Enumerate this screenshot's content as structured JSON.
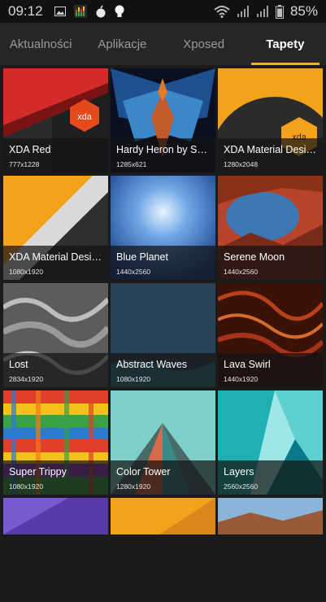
{
  "status_bar": {
    "time": "09:12",
    "battery": "85%",
    "left_icons": [
      "image-icon",
      "equalizer-app-icon",
      "bomb-icon",
      "lightbulb-icon"
    ],
    "right_icons": [
      "wifi-icon",
      "signal-icon",
      "signal-icon",
      "battery-icon"
    ]
  },
  "tabs": [
    {
      "label": "Aktualności",
      "active": false
    },
    {
      "label": "Aplikacje",
      "active": false
    },
    {
      "label": "Xposed",
      "active": false
    },
    {
      "label": "Tapety",
      "active": true
    }
  ],
  "accent_color": "#f2b01e",
  "wallpapers": [
    {
      "name": "XDA Red",
      "resolution": "777x1228"
    },
    {
      "name": "Hardy Heron by S Ri...",
      "resolution": "1285x621"
    },
    {
      "name": "XDA Material Desig...",
      "resolution": "1280x2048"
    },
    {
      "name": "XDA Material Design",
      "resolution": "1080x1920"
    },
    {
      "name": "Blue Planet",
      "resolution": "1440x2560"
    },
    {
      "name": "Serene Moon",
      "resolution": "1440x2560"
    },
    {
      "name": "Lost",
      "resolution": "2834x1920"
    },
    {
      "name": "Abstract Waves",
      "resolution": "1080x1920"
    },
    {
      "name": "Lava Swirl",
      "resolution": "1440x1920"
    },
    {
      "name": "Super Trippy",
      "resolution": "1080x1920"
    },
    {
      "name": "Color Tower",
      "resolution": "1280x1920"
    },
    {
      "name": "Layers",
      "resolution": "2560x2560"
    }
  ]
}
